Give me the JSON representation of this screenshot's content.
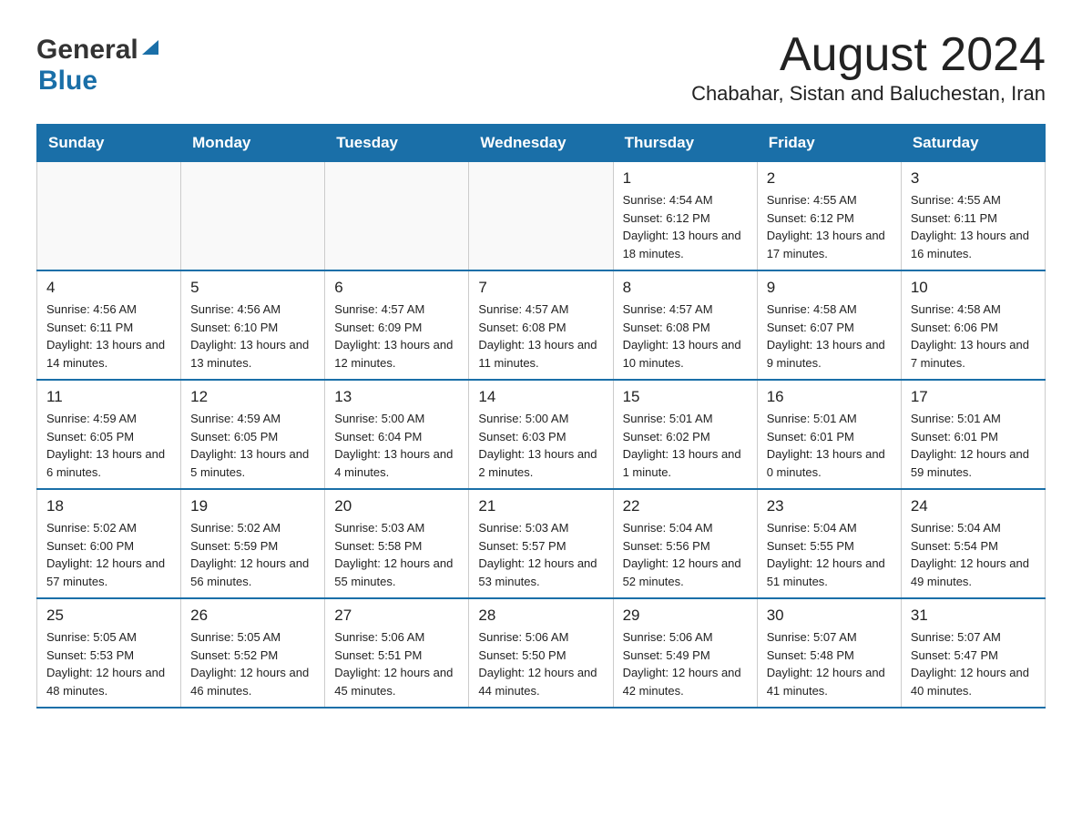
{
  "header": {
    "logo_general": "General",
    "logo_blue": "Blue",
    "month_title": "August 2024",
    "subtitle": "Chabahar, Sistan and Baluchestan, Iran"
  },
  "days_of_week": [
    "Sunday",
    "Monday",
    "Tuesday",
    "Wednesday",
    "Thursday",
    "Friday",
    "Saturday"
  ],
  "weeks": [
    [
      {
        "day": "",
        "info": ""
      },
      {
        "day": "",
        "info": ""
      },
      {
        "day": "",
        "info": ""
      },
      {
        "day": "",
        "info": ""
      },
      {
        "day": "1",
        "info": "Sunrise: 4:54 AM\nSunset: 6:12 PM\nDaylight: 13 hours and 18 minutes."
      },
      {
        "day": "2",
        "info": "Sunrise: 4:55 AM\nSunset: 6:12 PM\nDaylight: 13 hours and 17 minutes."
      },
      {
        "day": "3",
        "info": "Sunrise: 4:55 AM\nSunset: 6:11 PM\nDaylight: 13 hours and 16 minutes."
      }
    ],
    [
      {
        "day": "4",
        "info": "Sunrise: 4:56 AM\nSunset: 6:11 PM\nDaylight: 13 hours and 14 minutes."
      },
      {
        "day": "5",
        "info": "Sunrise: 4:56 AM\nSunset: 6:10 PM\nDaylight: 13 hours and 13 minutes."
      },
      {
        "day": "6",
        "info": "Sunrise: 4:57 AM\nSunset: 6:09 PM\nDaylight: 13 hours and 12 minutes."
      },
      {
        "day": "7",
        "info": "Sunrise: 4:57 AM\nSunset: 6:08 PM\nDaylight: 13 hours and 11 minutes."
      },
      {
        "day": "8",
        "info": "Sunrise: 4:57 AM\nSunset: 6:08 PM\nDaylight: 13 hours and 10 minutes."
      },
      {
        "day": "9",
        "info": "Sunrise: 4:58 AM\nSunset: 6:07 PM\nDaylight: 13 hours and 9 minutes."
      },
      {
        "day": "10",
        "info": "Sunrise: 4:58 AM\nSunset: 6:06 PM\nDaylight: 13 hours and 7 minutes."
      }
    ],
    [
      {
        "day": "11",
        "info": "Sunrise: 4:59 AM\nSunset: 6:05 PM\nDaylight: 13 hours and 6 minutes."
      },
      {
        "day": "12",
        "info": "Sunrise: 4:59 AM\nSunset: 6:05 PM\nDaylight: 13 hours and 5 minutes."
      },
      {
        "day": "13",
        "info": "Sunrise: 5:00 AM\nSunset: 6:04 PM\nDaylight: 13 hours and 4 minutes."
      },
      {
        "day": "14",
        "info": "Sunrise: 5:00 AM\nSunset: 6:03 PM\nDaylight: 13 hours and 2 minutes."
      },
      {
        "day": "15",
        "info": "Sunrise: 5:01 AM\nSunset: 6:02 PM\nDaylight: 13 hours and 1 minute."
      },
      {
        "day": "16",
        "info": "Sunrise: 5:01 AM\nSunset: 6:01 PM\nDaylight: 13 hours and 0 minutes."
      },
      {
        "day": "17",
        "info": "Sunrise: 5:01 AM\nSunset: 6:01 PM\nDaylight: 12 hours and 59 minutes."
      }
    ],
    [
      {
        "day": "18",
        "info": "Sunrise: 5:02 AM\nSunset: 6:00 PM\nDaylight: 12 hours and 57 minutes."
      },
      {
        "day": "19",
        "info": "Sunrise: 5:02 AM\nSunset: 5:59 PM\nDaylight: 12 hours and 56 minutes."
      },
      {
        "day": "20",
        "info": "Sunrise: 5:03 AM\nSunset: 5:58 PM\nDaylight: 12 hours and 55 minutes."
      },
      {
        "day": "21",
        "info": "Sunrise: 5:03 AM\nSunset: 5:57 PM\nDaylight: 12 hours and 53 minutes."
      },
      {
        "day": "22",
        "info": "Sunrise: 5:04 AM\nSunset: 5:56 PM\nDaylight: 12 hours and 52 minutes."
      },
      {
        "day": "23",
        "info": "Sunrise: 5:04 AM\nSunset: 5:55 PM\nDaylight: 12 hours and 51 minutes."
      },
      {
        "day": "24",
        "info": "Sunrise: 5:04 AM\nSunset: 5:54 PM\nDaylight: 12 hours and 49 minutes."
      }
    ],
    [
      {
        "day": "25",
        "info": "Sunrise: 5:05 AM\nSunset: 5:53 PM\nDaylight: 12 hours and 48 minutes."
      },
      {
        "day": "26",
        "info": "Sunrise: 5:05 AM\nSunset: 5:52 PM\nDaylight: 12 hours and 46 minutes."
      },
      {
        "day": "27",
        "info": "Sunrise: 5:06 AM\nSunset: 5:51 PM\nDaylight: 12 hours and 45 minutes."
      },
      {
        "day": "28",
        "info": "Sunrise: 5:06 AM\nSunset: 5:50 PM\nDaylight: 12 hours and 44 minutes."
      },
      {
        "day": "29",
        "info": "Sunrise: 5:06 AM\nSunset: 5:49 PM\nDaylight: 12 hours and 42 minutes."
      },
      {
        "day": "30",
        "info": "Sunrise: 5:07 AM\nSunset: 5:48 PM\nDaylight: 12 hours and 41 minutes."
      },
      {
        "day": "31",
        "info": "Sunrise: 5:07 AM\nSunset: 5:47 PM\nDaylight: 12 hours and 40 minutes."
      }
    ]
  ],
  "accent_color": "#1a6fa8"
}
